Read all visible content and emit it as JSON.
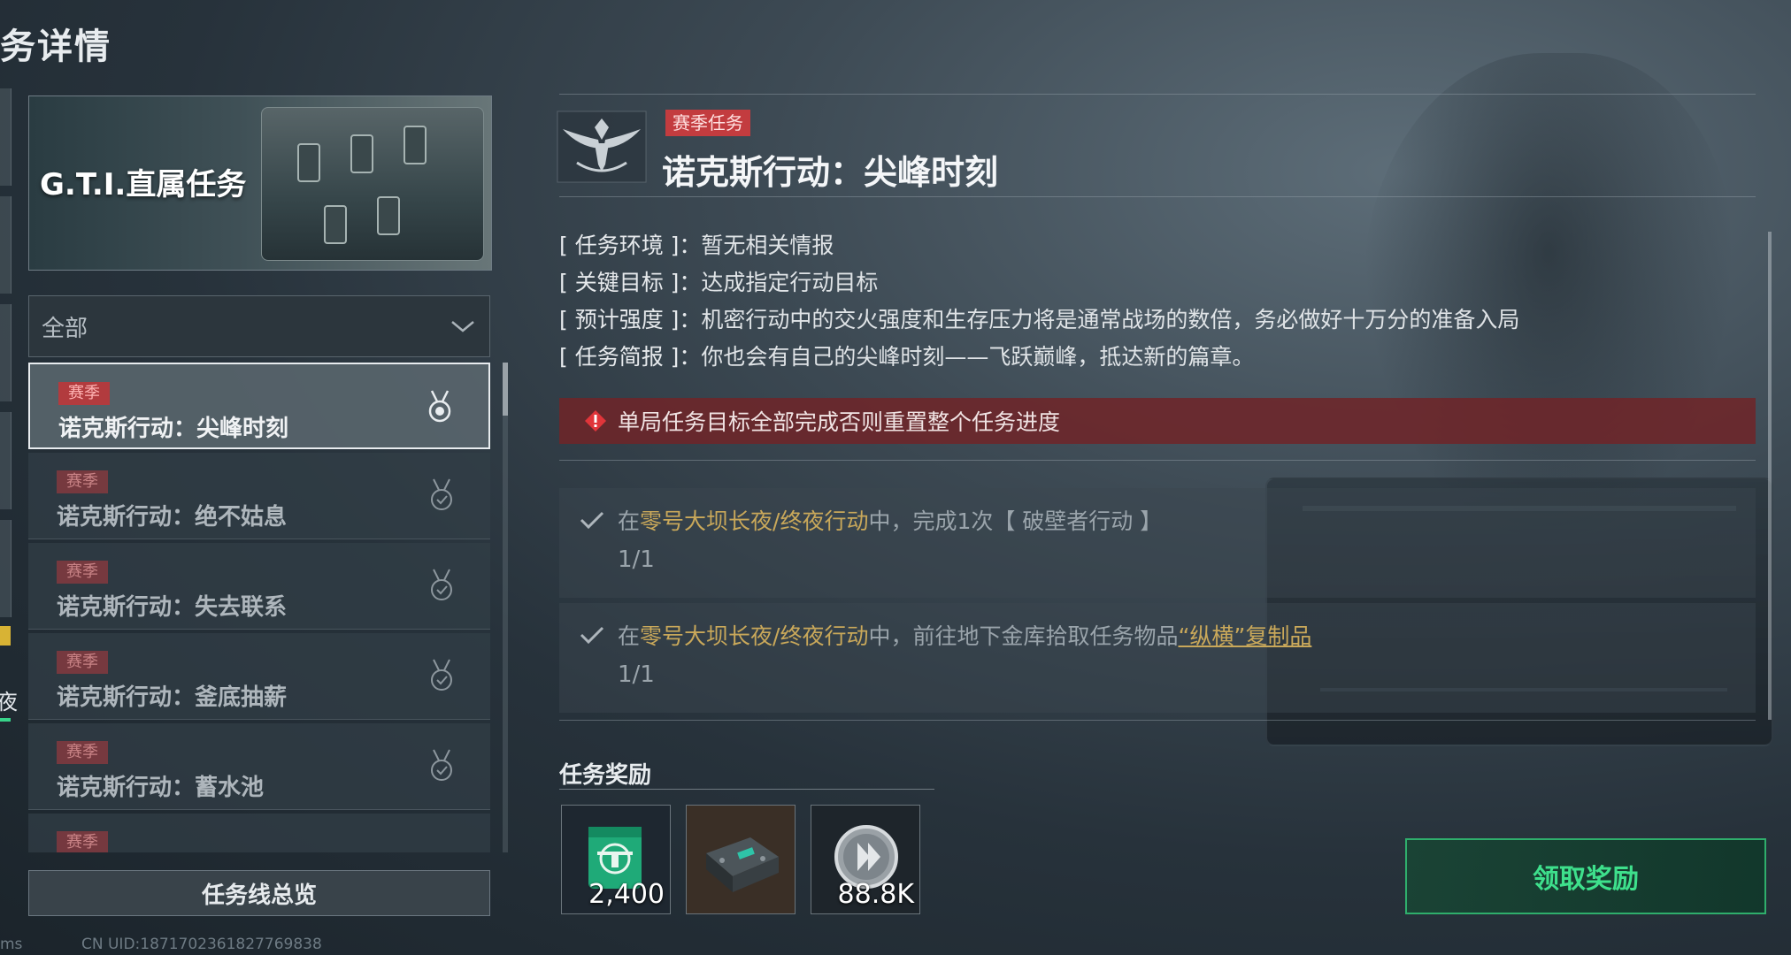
{
  "page": {
    "title": "务详情"
  },
  "banner": {
    "label": "G.T.I.直属任务"
  },
  "filter": {
    "value": "全部"
  },
  "task_list": [
    {
      "tag": "赛季",
      "name": "诺克斯行动：尖峰时刻"
    },
    {
      "tag": "赛季",
      "name": "诺克斯行动：绝不姑息"
    },
    {
      "tag": "赛季",
      "name": "诺克斯行动：失去联系"
    },
    {
      "tag": "赛季",
      "name": "诺克斯行动：釜底抽薪"
    },
    {
      "tag": "赛季",
      "name": "诺克斯行动：蓄水池"
    },
    {
      "tag": "赛季",
      "name": ""
    }
  ],
  "overview_button": "任务线总览",
  "footer": {
    "ping": "ms",
    "uid": "CN UID:1871702361827769838"
  },
  "rail": {
    "glyph": "夜"
  },
  "mission": {
    "tag": "赛季任务",
    "title": "诺克斯行动：尖峰时刻",
    "info": [
      {
        "key": "[ 任务环境 ]：",
        "value": "暂无相关情报"
      },
      {
        "key": "[ 关键目标 ]：",
        "value": "达成指定行动目标"
      },
      {
        "key": "[ 预计强度 ]：",
        "value": "机密行动中的交火强度和生存压力将是通常战场的数倍，务必做好十万分的准备入局"
      },
      {
        "key": "[ 任务简报 ]：",
        "value": "你也会有自己的尖峰时刻——飞跃巅峰，抵达新的篇章。"
      }
    ],
    "warning": "单局任务目标全部完成否则重置整个任务进度",
    "objectives": [
      {
        "prefix": "在",
        "location": "零号大坝长夜/终夜行动",
        "middle": "中，完成1次【 破壁者行动 】",
        "link": "",
        "progress": "1/1"
      },
      {
        "prefix": "在",
        "location": "零号大坝长夜/终夜行动",
        "middle": "中，前往地下金库拾取任务物品",
        "link": "“纵横”复制品",
        "progress": "1/1"
      }
    ]
  },
  "rewards": {
    "title": "任务奖励",
    "items": [
      {
        "icon": "helicopter-badge-icon",
        "qty": "2,400"
      },
      {
        "icon": "electronic-device-icon",
        "qty": ""
      },
      {
        "icon": "coin-icon",
        "qty": "88.8K"
      }
    ]
  },
  "claim_button": "领取奖励",
  "colors": {
    "accent_green": "#3ee08c",
    "season_red": "#c33c3f",
    "highlight_gold": "#c9a85a",
    "warning_bg": "#702428"
  }
}
